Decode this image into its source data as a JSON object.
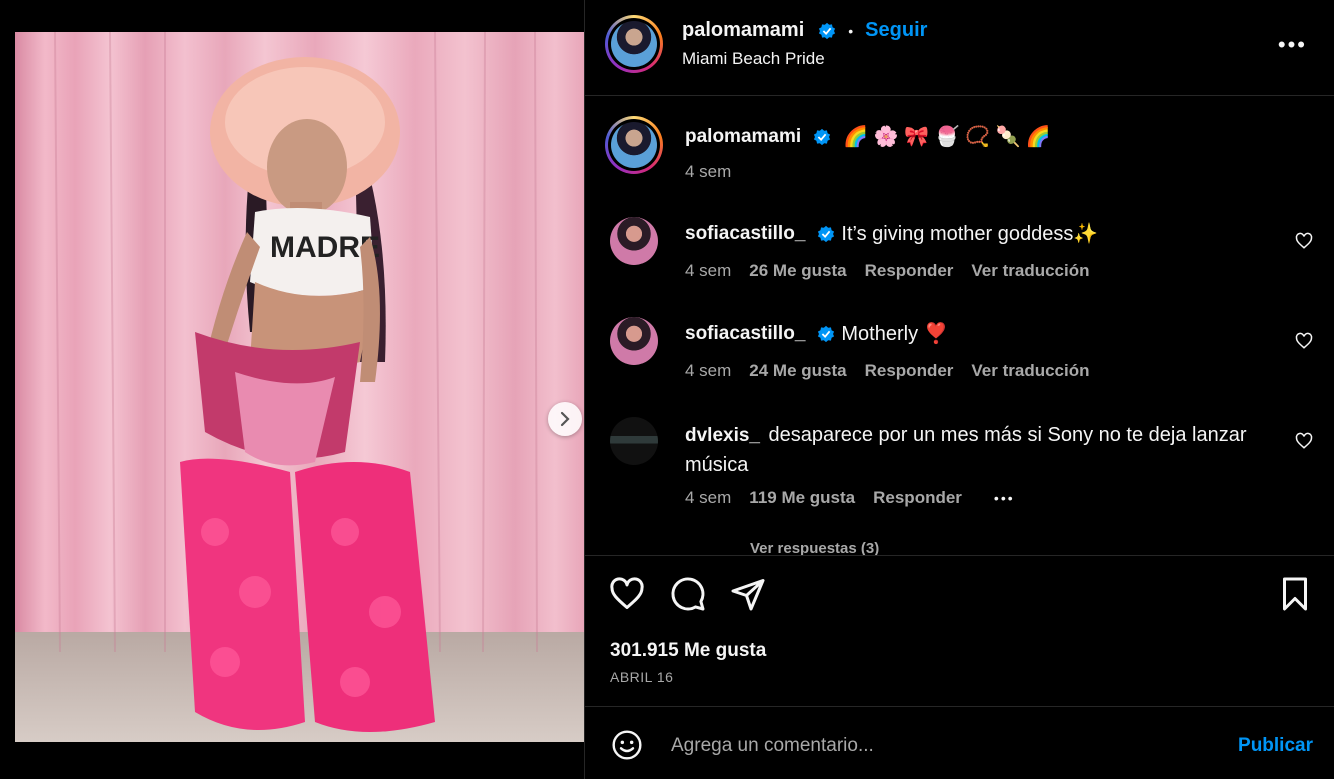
{
  "post": {
    "author": "palomamami",
    "follow_label": "Seguir",
    "separator": "•",
    "location": "Miami Beach Pride",
    "more": "•••"
  },
  "caption": {
    "author": "palomamami",
    "text": "🌈 🌸 🎀 🍧 📿 🍡 🌈",
    "time": "4 sem"
  },
  "comments": [
    {
      "user": "sofiacastillo_",
      "text": "It’s giving mother goddess✨",
      "time": "4 sem",
      "likes": "26 Me gusta",
      "reply": "Responder",
      "translate": "Ver traducción"
    },
    {
      "user": "sofiacastillo_",
      "text": "Motherly ❣️",
      "time": "4 sem",
      "likes": "24 Me gusta",
      "reply": "Responder",
      "translate": "Ver traducción"
    },
    {
      "user": "dvlexis_",
      "text": "desaparece por un mes más si Sony no te deja lanzar música",
      "time": "4 sem",
      "likes": "119 Me gusta",
      "reply": "Responder",
      "more": "•••",
      "view_replies": "Ver respuestas (3)"
    }
  ],
  "stats": {
    "likes": "301.915 Me gusta",
    "date": "ABRIL 16"
  },
  "composer": {
    "placeholder": "Agrega un comentario...",
    "publish": "Publicar"
  },
  "carousel": {
    "total_slides": 5,
    "active_slide": 1
  },
  "media": {
    "shirt_text": "MADRE"
  },
  "colors": {
    "accent": "#0095f6",
    "background": "#000000",
    "secondary_text": "#a8a8a8",
    "divider": "#262626"
  }
}
